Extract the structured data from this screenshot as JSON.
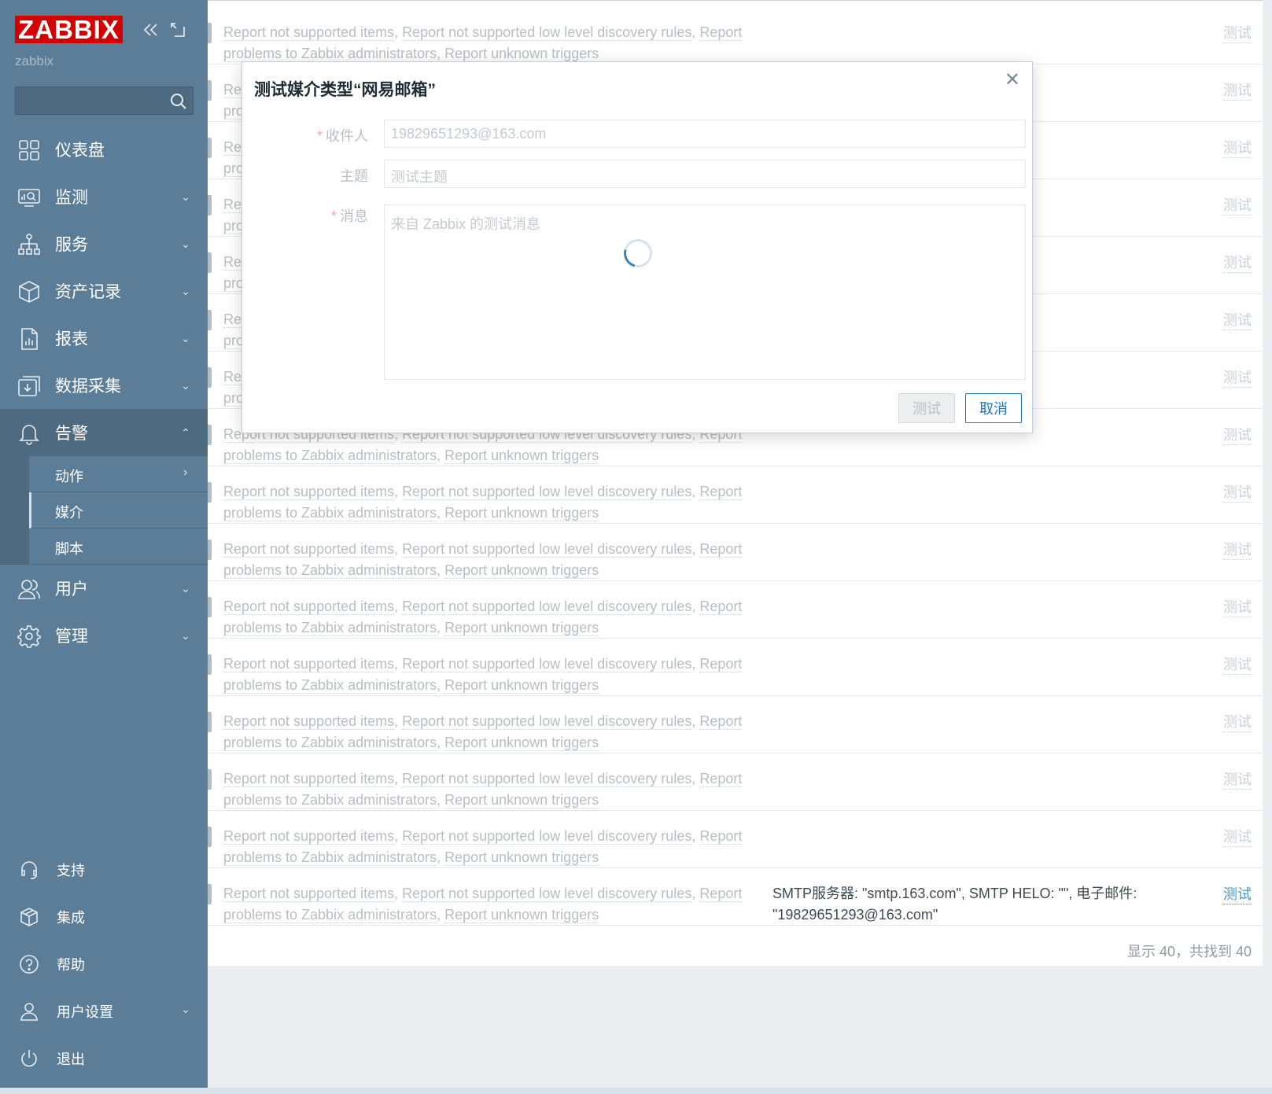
{
  "brand": {
    "logo": "ZABBIX",
    "server_name": "zabbix"
  },
  "sidebar": {
    "search_placeholder": "",
    "items": [
      {
        "label": "仪表盘",
        "icon": "dashboard-icon",
        "chevron": ""
      },
      {
        "label": "监测",
        "icon": "monitoring-icon",
        "chevron": "⌄"
      },
      {
        "label": "服务",
        "icon": "services-icon",
        "chevron": "⌄"
      },
      {
        "label": "资产记录",
        "icon": "inventory-icon",
        "chevron": "⌄"
      },
      {
        "label": "报表",
        "icon": "reports-icon",
        "chevron": "⌄"
      },
      {
        "label": "数据采集",
        "icon": "data-collection-icon",
        "chevron": "⌄"
      },
      {
        "label": "告警",
        "icon": "alerts-icon",
        "chevron": "⌃"
      }
    ],
    "sub_items": [
      {
        "label": "动作",
        "chevron": "›"
      },
      {
        "label": "媒介",
        "chevron": ""
      },
      {
        "label": "脚本",
        "chevron": ""
      }
    ],
    "items_after": [
      {
        "label": "用户",
        "icon": "users-icon",
        "chevron": "⌄"
      },
      {
        "label": "管理",
        "icon": "administration-icon",
        "chevron": "⌄"
      }
    ],
    "bottom": [
      {
        "label": "支持",
        "icon": "support-icon",
        "chevron": ""
      },
      {
        "label": "集成",
        "icon": "integrations-icon",
        "chevron": ""
      },
      {
        "label": "帮助",
        "icon": "help-icon",
        "chevron": ""
      },
      {
        "label": "用户设置",
        "icon": "user-settings-icon",
        "chevron": "⌄"
      },
      {
        "label": "退出",
        "icon": "sign-out-icon",
        "chevron": ""
      }
    ]
  },
  "list": {
    "action_links": {
      "a1": "Report not supported items",
      "a2": "Report not supported low level discovery rules",
      "a3": "Report problems to Zabbix administrators",
      "a4": "Report unknown triggers",
      "sep": ", "
    },
    "test_label": "测试",
    "last_details": "SMTP服务器: \"smtp.163.com\", SMTP HELO: \"\", 电子邮件: \"19829651293@163.com\"",
    "summary": "显示 40，共找到 40"
  },
  "modal": {
    "title": "测试媒介类型“网易邮箱”",
    "close": "✕",
    "fields": {
      "recipient_label": "收件人",
      "recipient_value": "19829651293@163.com",
      "subject_label": "主题",
      "subject_value": "测试主题",
      "message_label": "消息",
      "message_value": "来自 Zabbix 的测试消息"
    },
    "required_mark": "*",
    "btn_test": "测试",
    "btn_cancel": "取消"
  },
  "colors": {
    "sidebar": "#5c7d97",
    "logo": "#d40000",
    "link_active": "#4796c4",
    "primary": "#1e75b8"
  }
}
